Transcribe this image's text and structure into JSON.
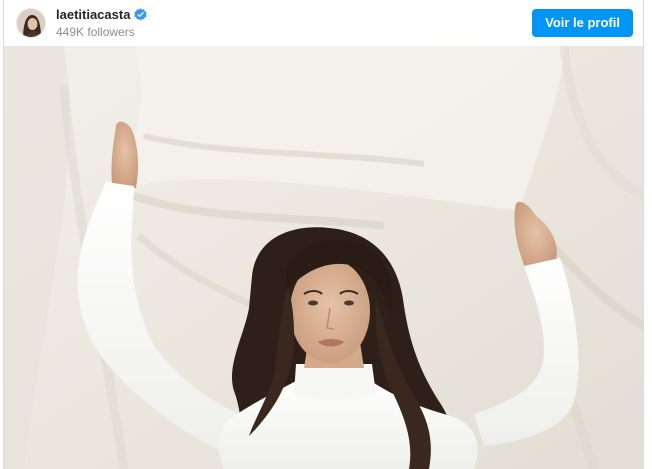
{
  "post": {
    "username": "laetitiacasta",
    "followers": "449K followers",
    "verified": true,
    "profile_button_label": "Voir le profil"
  },
  "icons": {
    "avatar": "profile-avatar",
    "verified": "verified-badge-icon"
  },
  "colors": {
    "button": "#0095f6",
    "verified": "#3897f0",
    "muted_text": "#8e8e8e"
  }
}
